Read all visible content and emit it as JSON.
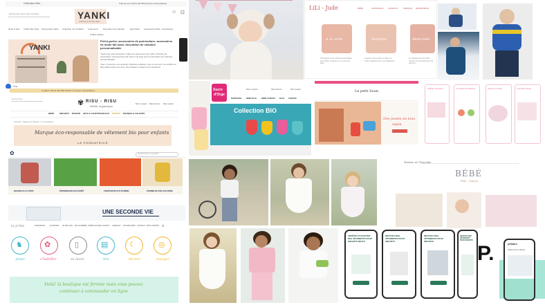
{
  "colors": {
    "yanki_peach": "#f6e4d9",
    "lili_pink": "#e7a9a3",
    "sucre_pink": "#e02a78",
    "sucre_teal": "#3aa7b7",
    "mint": "#d6f3ea",
    "green_script": "#78b646",
    "dark_navy": "#1d2b4e"
  },
  "yanki": {
    "topbar_left": "Collection Hiver",
    "topbar_right": "Frais de port offerts dès 80€ (France métropolitaine)",
    "search_placeholder": "Recherchez dans notre boutique",
    "logo": "YANKI",
    "logo_sub": "Clothing & Textile Gifts",
    "nav": [
      "Dodo & bain",
      "Coffret Ben Noël",
      "Prêt-à-porter bébé",
      "Collection mix & Match",
      "Linge de lit",
      "Décoration de chambre",
      "Eveil bébé",
      "Accessoires bébé",
      "Accessoires",
      "Cadeaux & bien-être"
    ],
    "nav_second": "Coffret cadeau",
    "hero_title": "Prêt-à-porter, accessoires de puériculture, accessoires de mode fait main, décoration de chambre personnalisable",
    "hero_p1": "Yanki c'est notre boutique en ligne de vêtements pour bébé, d'articles de puériculture, d'accessoires fait main et de linge de lit et décoration de chambre personnalisable.",
    "hero_p2": "Vous y trouverez une sélection d'articles tendance, que ce soit pour vos enfants ou faire plaisir autour de vous. Des cadeaux uniques pour naissance.",
    "chat_label": "Chat"
  },
  "risu": {
    "top": "Livraison offerte dès 60€ d'achat en France métropolitaine",
    "search_placeholder": "Rechercher...",
    "logo": "RISU - RISU",
    "logo_sub": "Mode organique",
    "nav": [
      "BÉBÉ",
      "ENFANTS",
      "MAISON",
      "JEUX & JOUETS",
      "CADEAUX",
      "OUTLET",
      "MARQUE & VALEURS"
    ],
    "breadcrumb": "Accueil > Marque & Valeurs > La fondatrice",
    "banner": "Marque éco-responsable de vêtement bio pour enfants",
    "banner_sub": "LA FONDATRICE",
    "links": [
      "Mon compte",
      "Mes favoris",
      "Mon panier"
    ]
  },
  "pp": {
    "search_placeholder": "Rechercher un produit",
    "items": [
      "HEUREUX AU PARC",
      "PROMENADE EN FORÊT",
      "FRAÎCHEUR D'AUTOMNE",
      "POMME DE PIN COLORÉE"
    ],
    "seconde": "UNE SECONDE VIE"
  },
  "elfe": {
    "logo": "la p'tite",
    "nav": [
      "NAISSANCE",
      "JE MANGE",
      "JE ME LAVE",
      "MA CHAMBRE",
      "PUÉRICULTURE",
      "JOUETS",
      "CADEAUX",
      "NOUVEAUTÉS",
      "CONTACT",
      "MON COMPTE"
    ],
    "icons": [
      "jouer",
      "s'habiller",
      "se laver",
      "lire",
      "dormir",
      "manger"
    ],
    "closed_msg_1": "Voilà! la boutique est fermée mais vous pouvez",
    "closed_msg_2": "continuer à commander en ligne"
  },
  "sucre": {
    "logo_a": "Sucre",
    "logo_b": "d'Orge",
    "collection": "Collection BIO",
    "links": [
      "Mon compte",
      "Mes favoris",
      "Mon panier"
    ],
    "nav": [
      "NOUVEAUTÉS",
      "NAISSANCE",
      "BÉBÉ FILLE",
      "BÉBÉ GARÇON",
      "FILLE",
      "GARÇON",
      "ACCESSOIRES"
    ]
  },
  "lili": {
    "logo": "LiLi - Jude",
    "nav": [
      "BÉBÉ",
      "NAISSANCE",
      "CADEAUX",
      "MARQUE",
      "REVENDEUR"
    ],
    "cards": [
      "A la carte",
      "Surprise",
      "Maternité"
    ],
    "cols": [
      "Composez votre coffret personnalisé pour bébé et ajoutez-y ce qui vous plaît.",
      "Laissez-vous guider et offrez un coffret surprise pour une naissance.",
      "Un cadeau pour la future maman et son bébé plein de douceur."
    ]
  },
  "petitsoun": {
    "logo": "Le petit Soun",
    "headline": "Des jouets en bois",
    "headline2": "sapin"
  },
  "apps": {
    "titles": [
      "Cadeau naissance",
      "Un Guide des Mamans",
      "Sophie La Girafe",
      "Une Mama Shop"
    ]
  },
  "tartine": {
    "logo": "Tartine et Chocolat",
    "title": "BÉBÉ",
    "sub": [
      "Fille",
      "Garçon"
    ]
  },
  "phones": {
    "headlines": [
      "ARRÊTEZ D'ACHETER DES VÊTEMENTS POUR ENFANTS NEUFS",
      "RECEVEZ DES VÊTEMENTS POUR ENFANTS",
      "RECEVEZ DES VÊTEMENTS POUR ENFANTS",
      "RECEVEZ DES VÊTEMENTS POUR ENFANTS"
    ]
  },
  "p_logo": "P.",
  "rightphone": {
    "brand": "petitbarn",
    "headline": "Vêtements enfants"
  }
}
